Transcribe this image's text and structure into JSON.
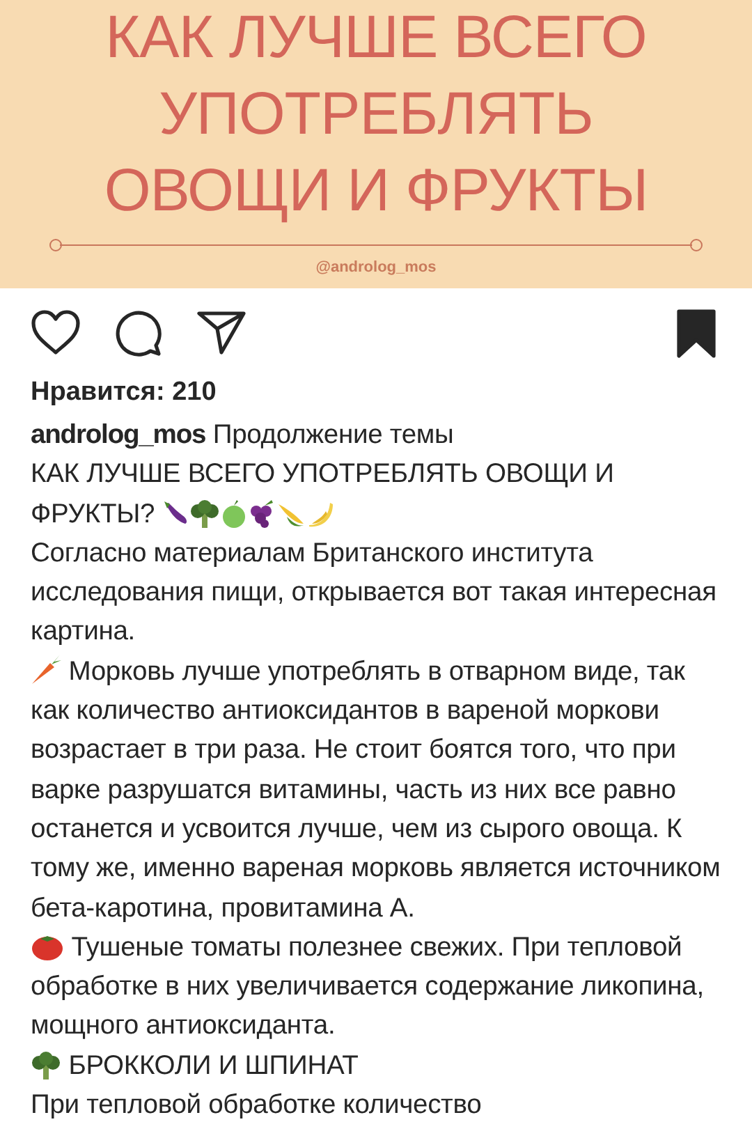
{
  "banner": {
    "title_lines": [
      "КАК ЛУЧШЕ ВСЕГО",
      "УПОТРЕБЛЯТЬ",
      "ОВОЩИ И ФРУКТЫ"
    ],
    "handle": "@androlog_mos"
  },
  "actions": {
    "saved": true
  },
  "likes": "Нравится: 210",
  "caption": {
    "username": "androlog_mos",
    "paragraphs": [
      {
        "kind": "lead",
        "text": "Продолжение темы"
      },
      {
        "kind": "fruits",
        "text": "КАК ЛУЧШЕ ВСЕГО УПОТРЕБЛЯТЬ ОВОЩИ И ФРУКТЫ?"
      },
      {
        "kind": "plain",
        "text": "Согласно материалам Британского института исследования пищи, открывается вот такая интересная картина."
      },
      {
        "kind": "carrot",
        "text": "Морковь лучше употреблять в отварном виде, так как количество антиоксидантов в вареной моркови возрастает в три раза. Не стоит боятся того, что при варке разрушатся витамины, часть из них все равно останется и усвоится лучше, чем из сырого овоща. К тому же, именно вареная морковь является  источником бета-каротина, провитамина А."
      },
      {
        "kind": "tomato",
        "text": "Тушеные томаты полезнее свежих. При тепловой обработке в них увеличивается содержание ликопина, мощного антиоксиданта."
      },
      {
        "kind": "broccoli",
        "text": "БРОККОЛИ И ШПИНАТ"
      },
      {
        "kind": "plain",
        "text": "При тепловой обработке количество"
      }
    ]
  }
}
